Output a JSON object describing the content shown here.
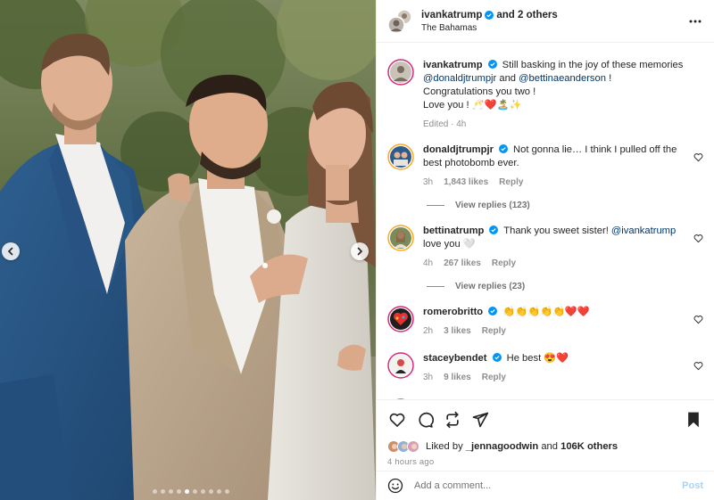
{
  "header": {
    "username": "ivankatrump",
    "and_others": "and 2 others",
    "location": "The Bahamas"
  },
  "caption": {
    "username": "ivankatrump",
    "text_before": "Still basking in the joy of these memories",
    "mention1": "@donaldjtrumpjr",
    "and": "and",
    "mention2": "@bettinaeanderson",
    "exclaim": "!",
    "line2": "Congratulations you two !",
    "line3": "Love you ! 🥂❤️🏝️✨",
    "edited": "Edited · 4h"
  },
  "comments": [
    {
      "username": "donaldjtrumpjr",
      "text": "Not gonna lie… I think I pulled off the best photobomb ever.",
      "time": "3h",
      "likes": "1,843 likes",
      "reply": "Reply",
      "view_replies": "View replies (123)"
    },
    {
      "username": "bettinatrump",
      "text_before": "Thank you sweet sister!",
      "mention": "@ivankatrump",
      "text_after": "love you 🤍",
      "time": "4h",
      "likes": "267 likes",
      "reply": "Reply",
      "view_replies": "View replies (23)"
    },
    {
      "username": "romerobritto",
      "text": "👏👏👏👏👏❤️❤️",
      "time": "2h",
      "likes": "3 likes",
      "reply": "Reply"
    },
    {
      "username": "staceybendet",
      "text": "He best 😍❤️",
      "time": "3h",
      "likes": "9 likes",
      "reply": "Reply"
    }
  ],
  "likes_bar": {
    "liked_by": "Liked by",
    "user": "_jennagoodwin",
    "and": "and",
    "others": "106K others",
    "time_ago": "4 hours ago"
  },
  "add_comment": {
    "placeholder": "Add a comment...",
    "post_label": "Post"
  },
  "carousel": {
    "dot_count": 10,
    "active_index": 4
  },
  "colors": {
    "link": "#00376b",
    "verified": "#0095f6",
    "post_button": "#a9d3f5"
  }
}
